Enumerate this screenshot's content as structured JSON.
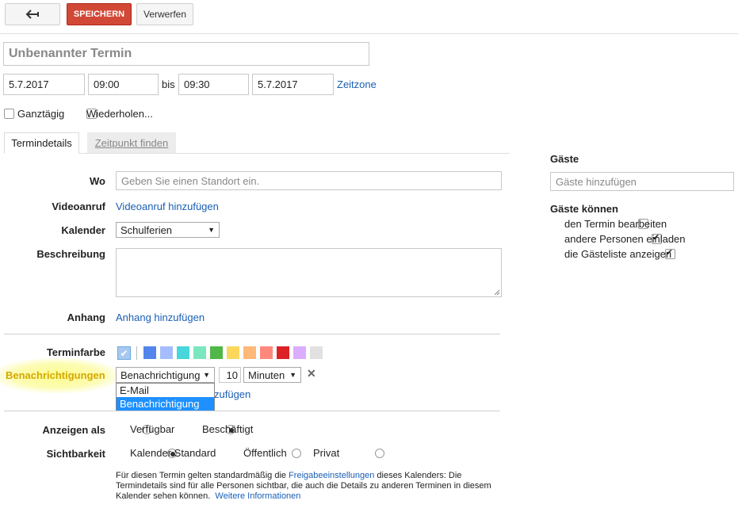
{
  "toolbar": {
    "back_icon": "back-arrow-icon",
    "save_label": "SPEICHERN",
    "discard_label": "Verwerfen"
  },
  "event": {
    "title_placeholder": "Unbenannter Termin",
    "start_date": "5.7.2017",
    "start_time": "09:00",
    "to_label": "bis",
    "end_time": "09:30",
    "end_date": "5.7.2017",
    "timezone_link": "Zeitzone",
    "all_day_label": "Ganztägig",
    "repeat_label": "Wiederholen..."
  },
  "tabs": [
    {
      "label": "Termindetails"
    },
    {
      "label": "Zeitpunkt finden"
    }
  ],
  "details": {
    "where_label": "Wo",
    "where_placeholder": "Geben Sie einen Standort ein.",
    "video_label": "Videoanruf",
    "video_link": "Videoanruf hinzufügen",
    "calendar_label": "Kalender",
    "calendar_value": "Schulferien",
    "description_label": "Beschreibung",
    "attachment_label": "Anhang",
    "attachment_link": "Anhang hinzufügen",
    "color_label": "Terminfarbe",
    "colors": [
      "#5484ed",
      "#a4bdfc",
      "#46d6db",
      "#7ae7bf",
      "#51b749",
      "#fbd75b",
      "#ffb878",
      "#ff887c",
      "#dc2127",
      "#dbadff",
      "#e1e1e1"
    ],
    "notifications_label": "Benachrichtigungen",
    "notification_type": "Benachrichtigung",
    "notification_amount": "10",
    "notification_unit": "Minuten",
    "notification_options": [
      "E-Mail",
      "Benachrichtigung"
    ],
    "add_notification_partial": "zufügen",
    "show_as_label": "Anzeigen als",
    "show_as_options": [
      "Verfügbar",
      "Beschäftigt"
    ],
    "visibility_label": "Sichtbarkeit",
    "visibility_options": [
      "Kalender Standard",
      "Öffentlich",
      "Privat"
    ],
    "info_text_1": "Für diesen Termin gelten standardmäßig die ",
    "info_link_1": "Freigabeeinstellungen",
    "info_text_2": " dieses Kalenders: Die",
    "info_text_3": "Termindetails sind für alle Personen sichtbar, die auch die Details zu anderen Terminen in diesem",
    "info_text_4": "Kalender sehen können.",
    "info_link_2": "Weitere Informationen"
  },
  "guests": {
    "heading": "Gäste",
    "add_placeholder": "Gäste hinzufügen",
    "can_heading": "Gäste können",
    "permissions": [
      {
        "label": "den Termin bearbeiten",
        "checked": false
      },
      {
        "label": "andere Personen einladen",
        "checked": true
      },
      {
        "label": "die Gästeliste anzeigen",
        "checked": true
      }
    ]
  }
}
